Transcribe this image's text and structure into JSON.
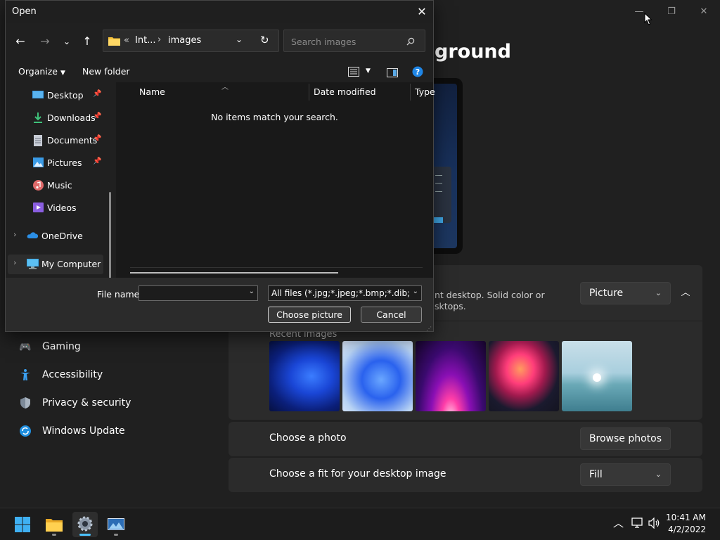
{
  "settings": {
    "heading_fragment": "ground",
    "description_lines": [
      "nt desktop. Solid color or",
      "sktops."
    ],
    "background_type": "Picture",
    "recent_images_label": "Recent images",
    "recent_images": [
      {
        "name": "bloom-dark-blue"
      },
      {
        "name": "bloom-light-blue"
      },
      {
        "name": "glow-purple"
      },
      {
        "name": "ribbon-flow"
      },
      {
        "name": "lake-sunrise"
      }
    ],
    "choose_photo_label": "Choose a photo",
    "browse_photos_label": "Browse photos",
    "choose_fit_label": "Choose a fit for your desktop image",
    "fit_value": "Fill",
    "nav": [
      {
        "label": "Gaming",
        "icon": "gamepad-icon"
      },
      {
        "label": "Accessibility",
        "icon": "accessibility-icon"
      },
      {
        "label": "Privacy & security",
        "icon": "shield-icon"
      },
      {
        "label": "Windows Update",
        "icon": "update-icon"
      }
    ],
    "window_controls": {
      "minimize": "—",
      "maximize": "❐",
      "close": "✕"
    }
  },
  "dialog": {
    "title": "Open",
    "close_glyph": "✕",
    "address": {
      "overflow": "«",
      "crumbs": [
        "Int...",
        "images"
      ]
    },
    "search_placeholder": "Search images",
    "organize_label": "Organize",
    "new_folder_label": "New folder",
    "nav_tree": [
      {
        "label": "Desktop",
        "pinned": true
      },
      {
        "label": "Downloads",
        "pinned": true
      },
      {
        "label": "Documents",
        "pinned": true
      },
      {
        "label": "Pictures",
        "pinned": true
      },
      {
        "label": "Music",
        "pinned": false
      },
      {
        "label": "Videos",
        "pinned": false
      },
      {
        "label": "OneDrive",
        "pinned": false
      },
      {
        "label": "My Computer",
        "pinned": false
      }
    ],
    "columns": [
      "Name",
      "Date modified",
      "Type"
    ],
    "empty_message": "No items match your search.",
    "file_name_label": "File name:",
    "file_name_value": "",
    "file_type_value": "All files (*.jpg;*.jpeg;*.bmp;*.dib;*.png",
    "choose_button": "Choose picture",
    "cancel_button": "Cancel"
  },
  "taskbar": {
    "apps": [
      "start",
      "file-explorer",
      "settings",
      "photos"
    ],
    "time": "10:41 AM",
    "date": "4/2/2022"
  },
  "colors": {
    "accent": "#0078d4",
    "folder": "#f8c33b",
    "background": "#202020"
  }
}
